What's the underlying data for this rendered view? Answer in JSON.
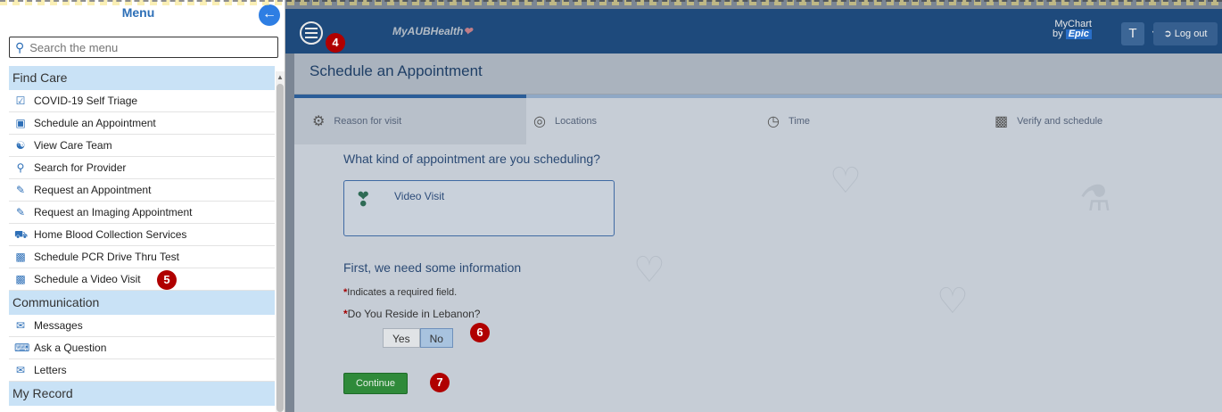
{
  "sidebar": {
    "title": "Menu",
    "search_placeholder": "Search the menu",
    "sections": [
      {
        "heading": "Find Care",
        "items": [
          {
            "label": "COVID-19 Self Triage",
            "icon": "clipboard-check-icon"
          },
          {
            "label": "Schedule an Appointment",
            "icon": "calendar-add-icon"
          },
          {
            "label": "View Care Team",
            "icon": "care-team-icon"
          },
          {
            "label": "Search for Provider",
            "icon": "search-icon"
          },
          {
            "label": "Request an Appointment",
            "icon": "request-form-icon"
          },
          {
            "label": "Request an Imaging Appointment",
            "icon": "request-form-icon"
          },
          {
            "label": "Home Blood Collection Services",
            "icon": "truck-icon"
          },
          {
            "label": "Schedule PCR Drive Thru Test",
            "icon": "calendar-icon"
          },
          {
            "label": "Schedule a Video Visit",
            "icon": "calendar-icon"
          }
        ]
      },
      {
        "heading": "Communication",
        "items": [
          {
            "label": "Messages",
            "icon": "envelope-icon"
          },
          {
            "label": "Ask a Question",
            "icon": "chat-icon"
          },
          {
            "label": "Letters",
            "icon": "letter-icon"
          }
        ]
      },
      {
        "heading": "My Record",
        "items": []
      }
    ]
  },
  "header": {
    "logo_text": "AUBHealth",
    "logo_prefix": "My",
    "mychart_label": "MyChart",
    "mychart_by": "by",
    "epic_label": "Epic",
    "user_initial": "T",
    "logout_label": "Log out"
  },
  "page": {
    "title": "Schedule an Appointment",
    "steps": [
      {
        "label": "Reason for visit",
        "icon": "medkit-icon",
        "active": true
      },
      {
        "label": "Locations",
        "icon": "location-icon",
        "active": false
      },
      {
        "label": "Time",
        "icon": "clock-icon",
        "active": false
      },
      {
        "label": "Verify and schedule",
        "icon": "calendar-icon",
        "active": false
      }
    ],
    "question1": "What kind of appointment are you scheduling?",
    "visit_type": "Video Visit",
    "question2": "First, we need some information",
    "required_note": "Indicates a required field.",
    "reside_question": "Do You Reside in Lebanon?",
    "yes_label": "Yes",
    "no_label": "No",
    "selected_answer": "No",
    "continue_label": "Continue"
  },
  "annotations": {
    "b4": "4",
    "b5": "5",
    "b6": "6",
    "b7": "7"
  },
  "colors": {
    "accent": "#1e4a7c",
    "section_bg": "#c9e2f6",
    "continue": "#2f8a3a",
    "badge": "#b00000"
  }
}
